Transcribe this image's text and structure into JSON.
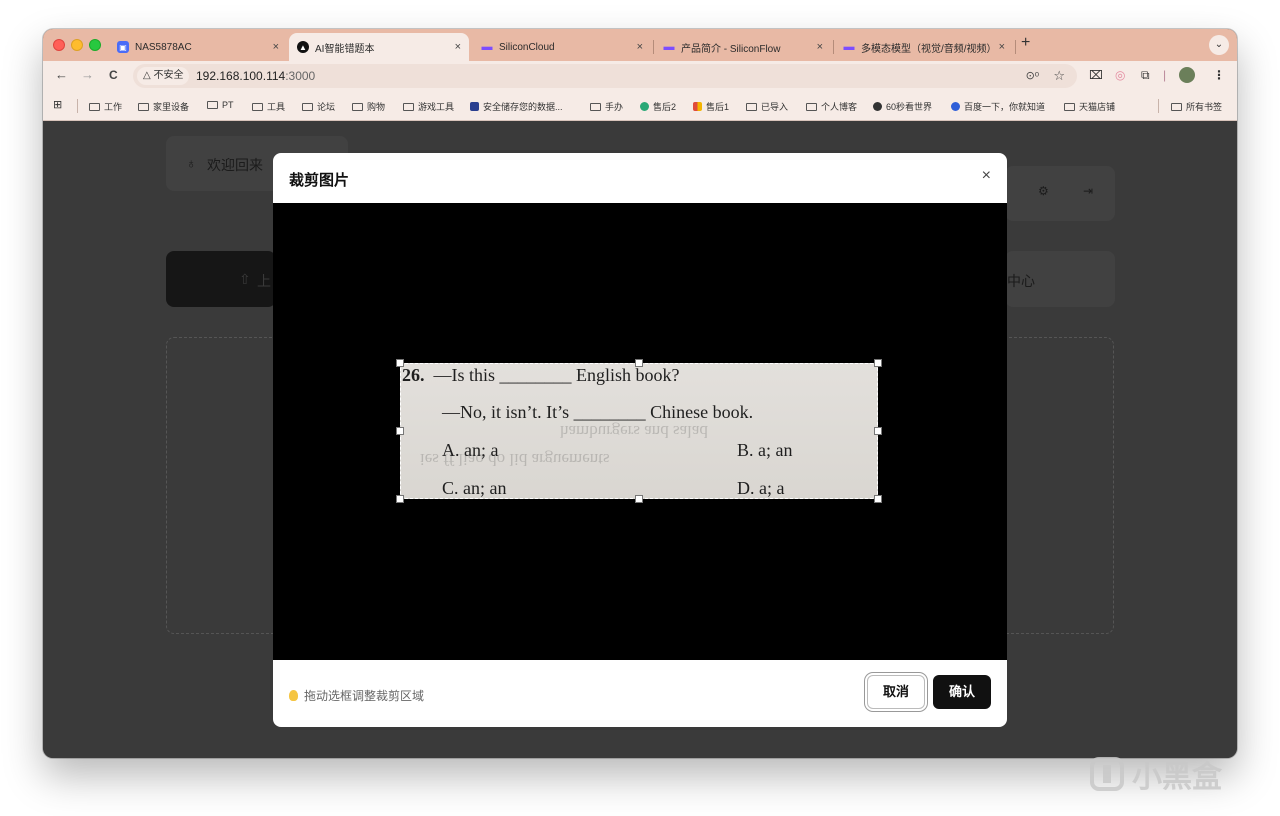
{
  "browser": {
    "tabs": [
      {
        "title": "NAS5878AC",
        "icon": "nas-app-icon",
        "color": "#4a6cf7",
        "active": false
      },
      {
        "title": "AI智能错题本",
        "icon": "app-circle-icon",
        "color": "#111111",
        "active": true
      },
      {
        "title": "SiliconCloud",
        "icon": "siliconflow-icon",
        "color": "#7c4dff",
        "active": false
      },
      {
        "title": "产品简介 - SiliconFlow",
        "icon": "siliconflow-icon",
        "color": "#7c4dff",
        "active": false
      },
      {
        "title": "多模态模型（视觉/音频/视频）",
        "icon": "siliconflow-icon",
        "color": "#7c4dff",
        "active": false
      }
    ],
    "tab_close": "×",
    "new_tab": "+",
    "tab_menu": "⌄",
    "nav": {
      "back": "←",
      "forward": "→",
      "reload": "C"
    },
    "security_label": "△ 不安全",
    "url_host": "192.168.100.114",
    "url_port": ":3000",
    "bookmarks": [
      {
        "label": "工作",
        "type": "folder"
      },
      {
        "label": "家里设备",
        "type": "folder"
      },
      {
        "label": "PT",
        "type": "folder"
      },
      {
        "label": "工具",
        "type": "folder"
      },
      {
        "label": "论坛",
        "type": "folder"
      },
      {
        "label": "购物",
        "type": "folder"
      },
      {
        "label": "游戏工具",
        "type": "folder"
      },
      {
        "label": "安全储存您的数据...",
        "type": "site",
        "color": "#2a3f8f"
      },
      {
        "label": "手办",
        "type": "folder"
      },
      {
        "label": "售后2",
        "type": "site",
        "color": "#2aa876"
      },
      {
        "label": "售后1",
        "type": "site",
        "color": "#e04b3b"
      },
      {
        "label": "已导入",
        "type": "folder"
      },
      {
        "label": "个人博客",
        "type": "folder"
      },
      {
        "label": "60秒看世界",
        "type": "site",
        "color": "#333333"
      },
      {
        "label": "百度一下，你就知道",
        "type": "site",
        "color": "#2f5fd8"
      },
      {
        "label": "天猫店铺",
        "type": "folder"
      }
    ],
    "all_bookmarks": "所有书签"
  },
  "page": {
    "welcome": "欢迎回来",
    "upload_short": "上",
    "center_tab": "中心"
  },
  "modal": {
    "title": "裁剪图片",
    "close": "×",
    "hint": "拖动选框调整裁剪区域",
    "cancel": "取消",
    "confirm": "确认",
    "image_text": {
      "qnum": "26.",
      "line1": "—Is this ________ English book?",
      "line2": "—No, it isn’t.  It’s ________ Chinese book.",
      "opt_a": "A.  an; a",
      "opt_b": "B.  a; an",
      "opt_c": "C.  an; an",
      "opt_d": "D.  a; a"
    }
  },
  "watermark": "小黑盒"
}
